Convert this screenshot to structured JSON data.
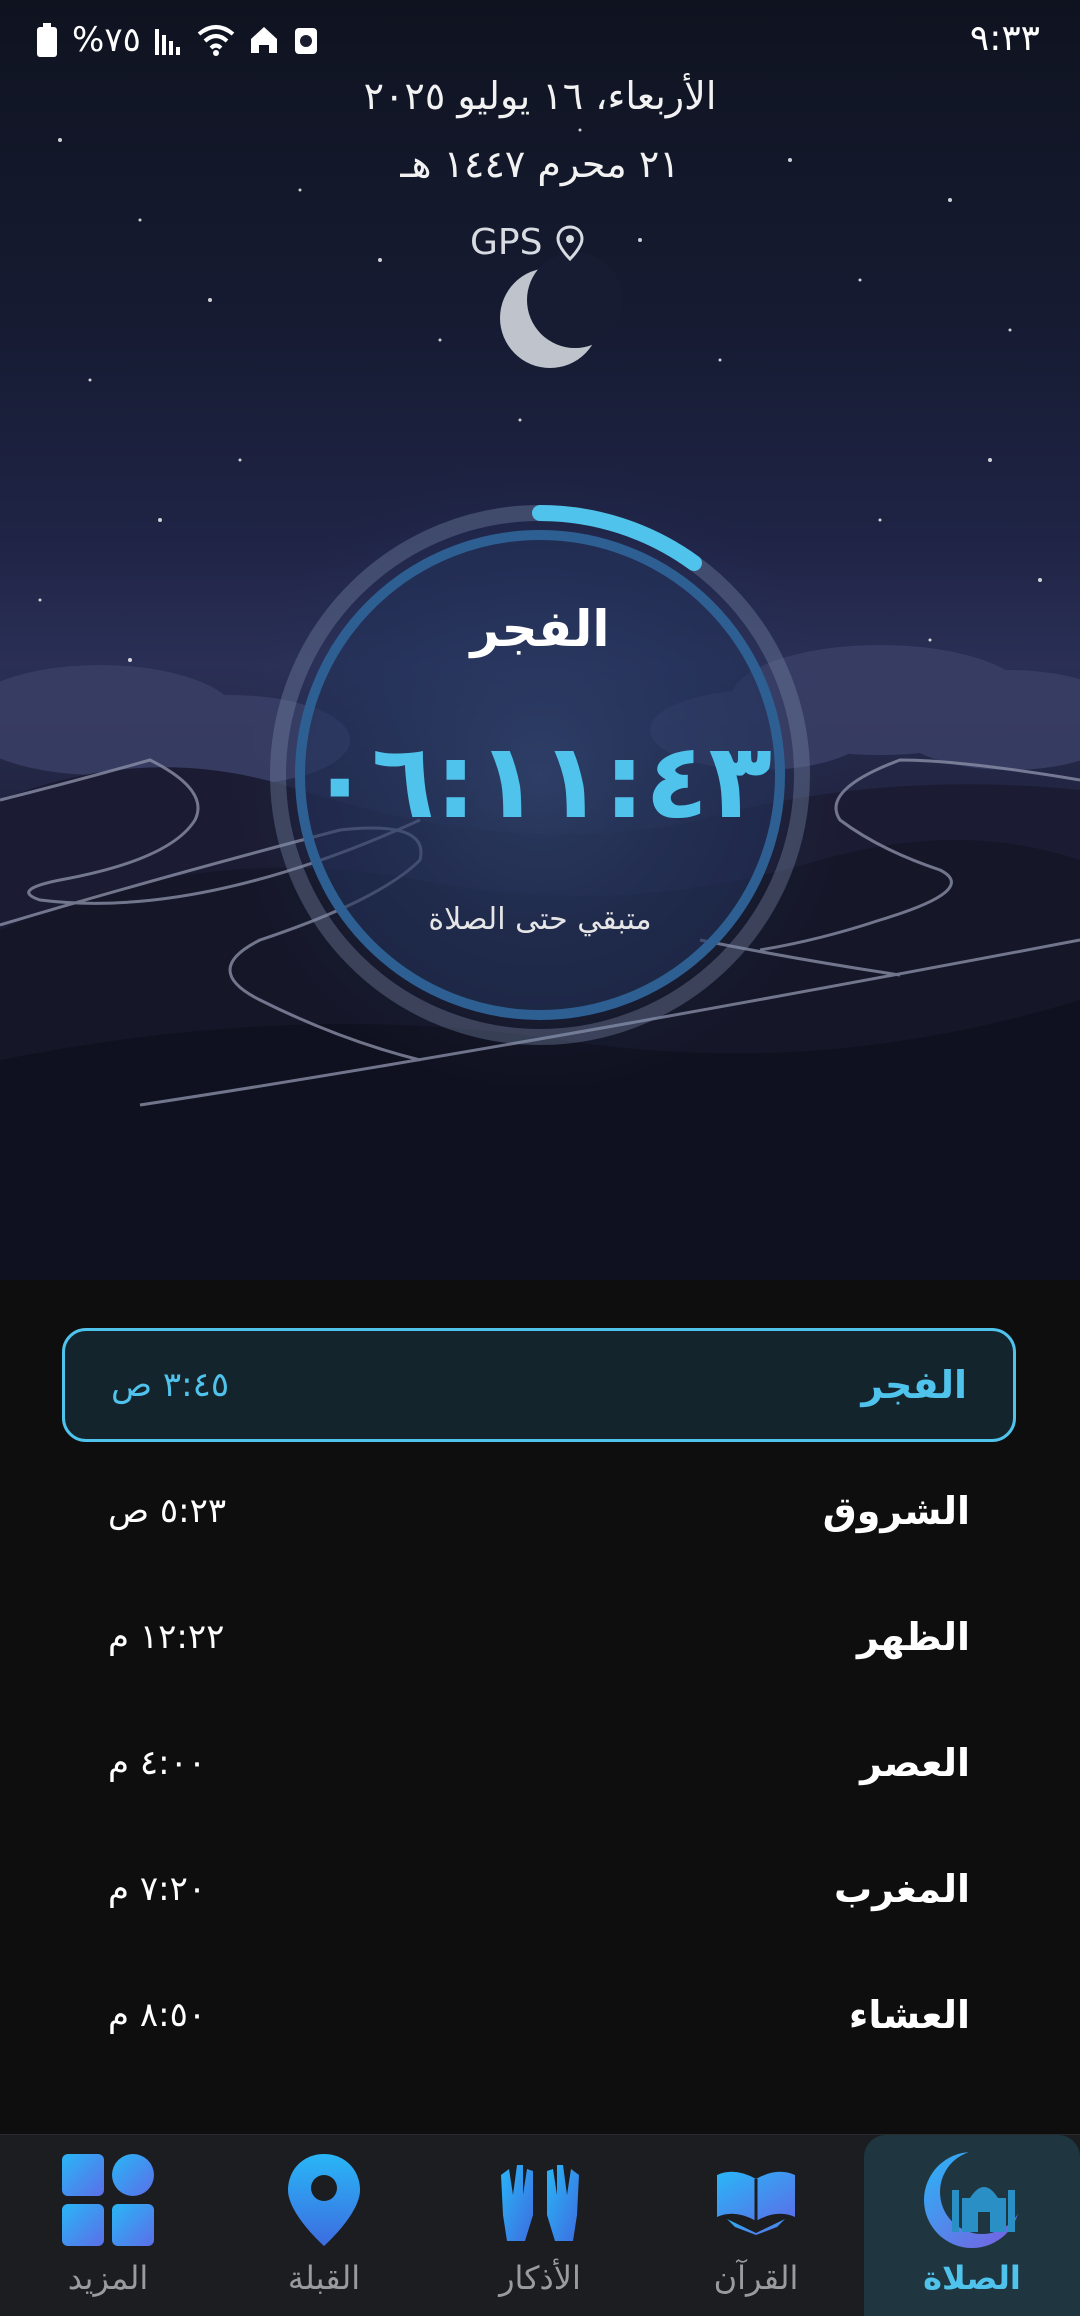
{
  "status_bar": {
    "time": "٩:٣٣",
    "battery": "%٧٥"
  },
  "header": {
    "gregorian_date": "الأربعاء، ١٦ يوليو ٢٠٢٥",
    "hijri_date": "٢١ محرم ١٤٤٧ هـ",
    "location_label": "GPS"
  },
  "countdown": {
    "prayer_name": "الفجر",
    "time_remaining": "٠٦:١١:٤٣",
    "caption": "متبقي حتى الصلاة",
    "progress_fraction": 0.1
  },
  "prayers": [
    {
      "name": "الفجر",
      "time": "٣:٤٥ ص",
      "active": true
    },
    {
      "name": "الشروق",
      "time": "٥:٢٣ ص",
      "active": false
    },
    {
      "name": "الظهر",
      "time": "١٢:٢٢ م",
      "active": false
    },
    {
      "name": "العصر",
      "time": "٤:٠٠ م",
      "active": false
    },
    {
      "name": "المغرب",
      "time": "٧:٢٠ م",
      "active": false
    },
    {
      "name": "العشاء",
      "time": "٨:٥٠ م",
      "active": false
    }
  ],
  "nav": [
    {
      "label": "المزيد",
      "icon": "grid-icon",
      "active": false
    },
    {
      "label": "القبلة",
      "icon": "location-pin-icon",
      "active": false
    },
    {
      "label": "الأذكار",
      "icon": "praying-hands-icon",
      "active": false
    },
    {
      "label": "القرآن",
      "icon": "quran-book-icon",
      "active": false
    },
    {
      "label": "الصلاة",
      "icon": "mosque-crescent-icon",
      "active": true
    }
  ],
  "colors": {
    "accent": "#4fc3ec",
    "background": "#0e0e0f",
    "active_row_bg": "#14242d",
    "nav_bg": "#1c1d20"
  }
}
